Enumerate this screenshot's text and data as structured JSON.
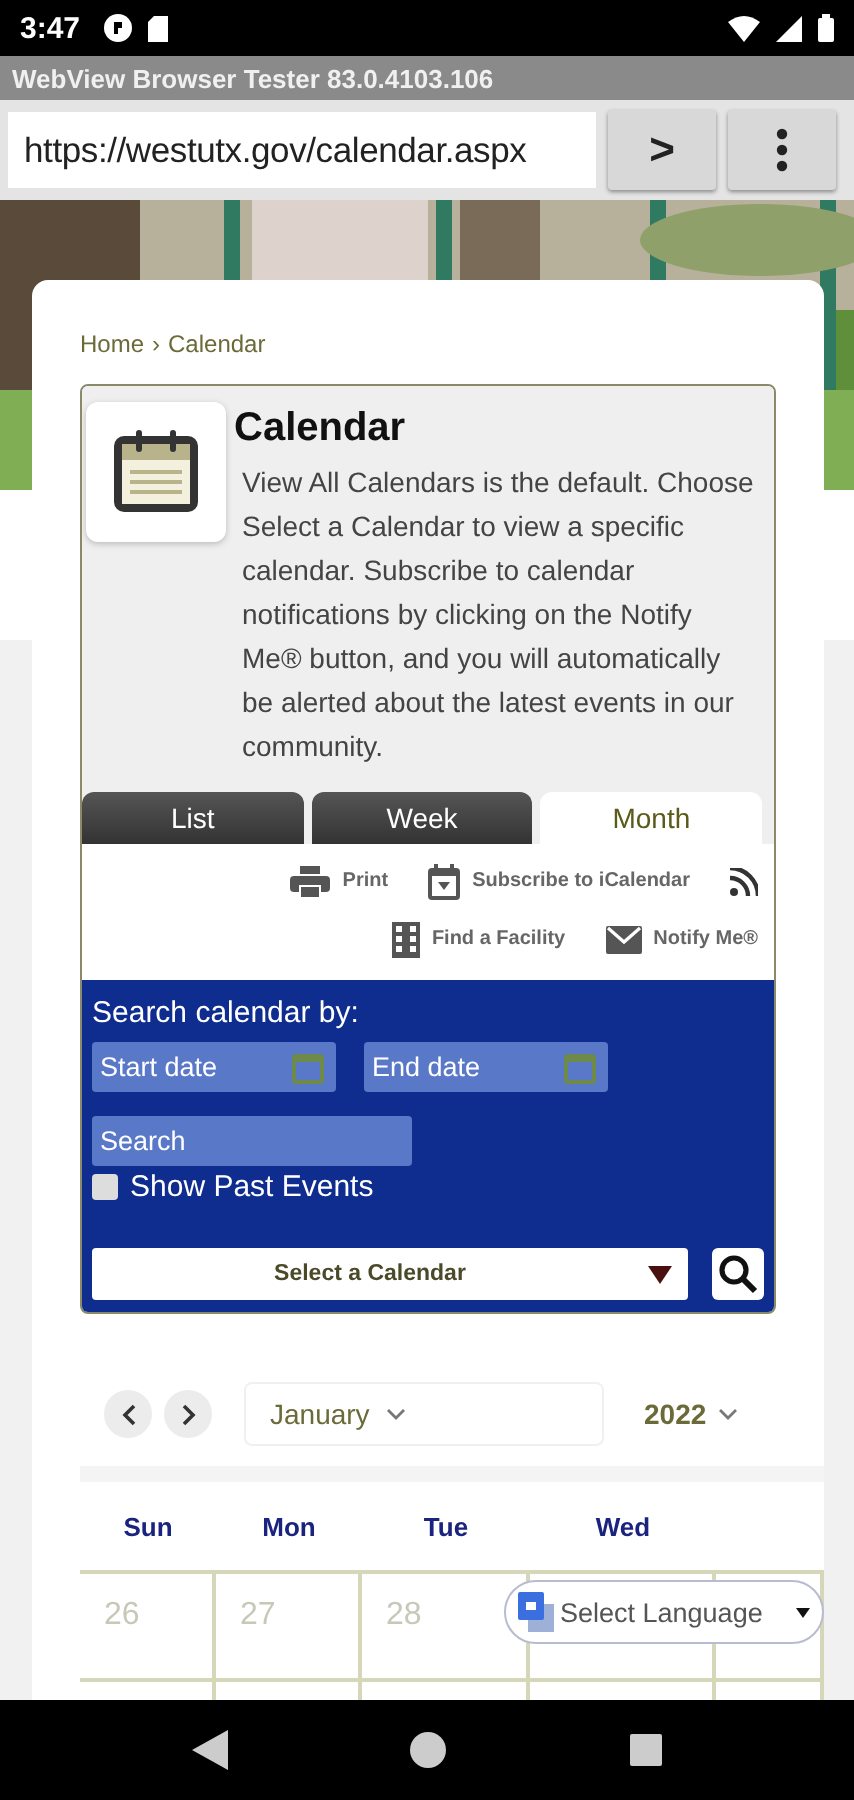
{
  "status_bar": {
    "time": "3:47"
  },
  "app_bar": {
    "title": "WebView Browser Tester 83.0.4103.106"
  },
  "url_bar": {
    "url": "https://westutx.gov/calendar.aspx",
    "go": ">"
  },
  "breadcrumb": {
    "items": [
      {
        "label": "Home"
      },
      {
        "label": "Calendar"
      }
    ],
    "separator": "›"
  },
  "calendar_header": {
    "title": "Calendar",
    "description": "View All Calendars is the default. Choose Select a Calendar to view a specific calendar. Subscribe to calendar notifications by clicking on the Notify Me® button, and you will automatically be alerted about the latest events in our community."
  },
  "tabs": [
    {
      "label": "List",
      "selected": false
    },
    {
      "label": "Week",
      "selected": false
    },
    {
      "label": "Month",
      "selected": true
    }
  ],
  "tool_rows": [
    [
      {
        "kind": "print",
        "label": "Print"
      },
      {
        "kind": "subscribe",
        "label": "Subscribe to iCalendar"
      },
      {
        "kind": "rss"
      }
    ],
    [
      {
        "kind": "facility",
        "label": "Find a Facility"
      },
      {
        "kind": "notify",
        "label": "Notify Me®"
      }
    ]
  ],
  "search_panel": {
    "heading": "Search calendar by:",
    "start_date": {
      "placeholder": "Start date"
    },
    "end_date": {
      "placeholder": "End date"
    },
    "search": {
      "placeholder": "Search"
    },
    "show_past_events": {
      "label": "Show Past Events",
      "checked": false
    },
    "calendar_select": {
      "value": "Select a Calendar"
    }
  },
  "calendar_nav": {
    "month": "January",
    "year": "2022"
  },
  "weekdays": [
    "Sun",
    "Mon",
    "Tue",
    "Wed"
  ],
  "date_row": [
    {
      "day": "26",
      "outside_month": true
    },
    {
      "day": "27",
      "outside_month": true
    },
    {
      "day": "28",
      "outside_month": true
    }
  ],
  "language_select": {
    "value": "Select Language"
  }
}
